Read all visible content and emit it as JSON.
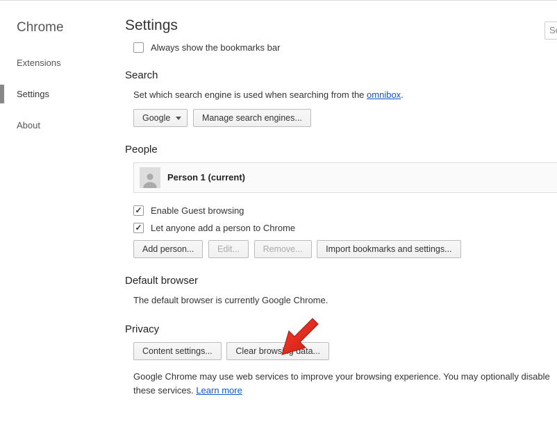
{
  "sidebar": {
    "title": "Chrome",
    "items": [
      {
        "label": "Extensions",
        "active": false
      },
      {
        "label": "Settings",
        "active": true
      },
      {
        "label": "About",
        "active": false
      }
    ]
  },
  "page_title": "Settings",
  "search_placeholder": "Se",
  "appearance": {
    "always_show_bookmarks": {
      "label": "Always show the bookmarks bar",
      "checked": false
    }
  },
  "search": {
    "heading": "Search",
    "desc_prefix": "Set which search engine is used when searching from the ",
    "desc_link": "omnibox",
    "desc_suffix": ".",
    "engine_selected": "Google",
    "manage_btn": "Manage search engines..."
  },
  "people": {
    "heading": "People",
    "current_name": "Person 1 (current)",
    "guest": {
      "label": "Enable Guest browsing",
      "checked": true
    },
    "add_anyone": {
      "label": "Let anyone add a person to Chrome",
      "checked": true
    },
    "add_btn": "Add person...",
    "edit_btn": "Edit...",
    "remove_btn": "Remove...",
    "import_btn": "Import bookmarks and settings..."
  },
  "default_browser": {
    "heading": "Default browser",
    "text": "The default browser is currently Google Chrome."
  },
  "privacy": {
    "heading": "Privacy",
    "content_btn": "Content settings...",
    "clear_btn": "Clear browsing data...",
    "desc_prefix": "Google Chrome may use web services to improve your browsing experience. You may optionally disable these services. ",
    "learn_more": "Learn more"
  }
}
